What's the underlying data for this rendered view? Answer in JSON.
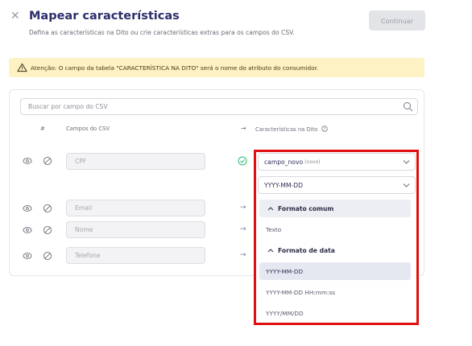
{
  "header": {
    "close_icon": "close-icon",
    "title": "Mapear características",
    "subtitle": "Defina as características na Dito ou crie características extras para os campos do CSV.",
    "continue_label": "Continuar"
  },
  "alert": {
    "icon": "warning-icon",
    "text": "Atenção: O campo da tabela \"CARACTERÍSTICA NA DITO\" será o nome do atributo do consumidor."
  },
  "search": {
    "placeholder": "Buscar por campo do CSV",
    "icon": "search-icon"
  },
  "table": {
    "headers": {
      "number": "#",
      "csv_fields": "Campos do CSV",
      "arrow": "→",
      "dito_characteristics": "Características na Dito"
    },
    "rows": [
      {
        "field": "CPF",
        "mapping": "campo_novo",
        "mapping_tag": "(novo)"
      },
      {
        "field": "Email",
        "arrow": "→"
      },
      {
        "field": "Nome",
        "arrow": "→"
      },
      {
        "field": "Telefone",
        "arrow": "→"
      }
    ]
  },
  "format_select": {
    "value": "YYYY-MM-DD"
  },
  "dropdown": {
    "groups": [
      {
        "label": "Formato comum",
        "options": [
          "Texto"
        ]
      },
      {
        "label": "Formato de data",
        "options": [
          "YYYY-MM-DD",
          "YYYY-MM-DD HH:mm:ss",
          "YYYY/MM/DD"
        ]
      }
    ],
    "selected": "YYYY-MM-DD"
  },
  "colors": {
    "title": "#2b2f6b",
    "alert_bg": "#fdf2c4",
    "highlight_border": "#e11010",
    "check": "#2eb872"
  }
}
